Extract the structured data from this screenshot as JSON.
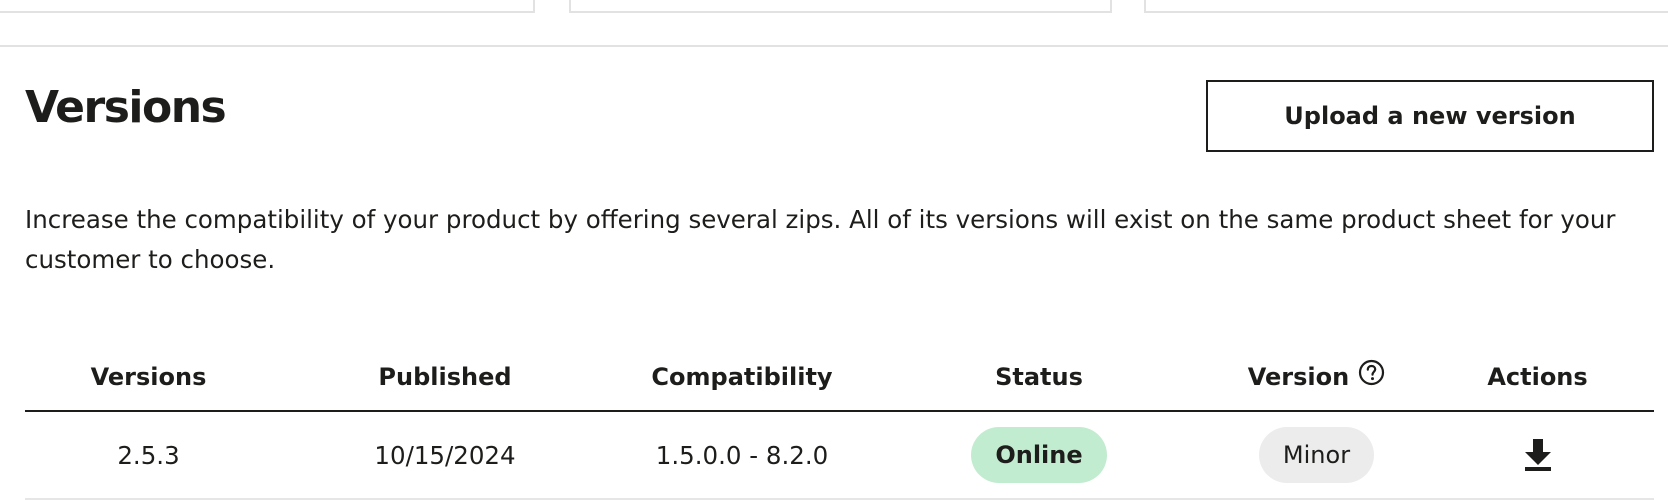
{
  "header": {
    "title": "Versions",
    "upload_label": "Upload a new version"
  },
  "description": "Increase the compatibility of your product by offering several zips. All of its versions will exist on the same product sheet for your customer to choose.",
  "table": {
    "columns": [
      "Versions",
      "Published",
      "Compatibility",
      "Status",
      "Version",
      "Actions"
    ],
    "rows": [
      {
        "version": "2.5.3",
        "published": "10/15/2024",
        "compatibility": "1.5.0.0 - 8.2.0",
        "status": "Online",
        "version_type": "Minor",
        "action_icon": "download-icon"
      }
    ]
  },
  "colors": {
    "text": "#1d1d1b",
    "online_badge_bg": "#c2ecd0",
    "minor_badge_bg": "#ececec",
    "border_light": "#e2e2e2"
  },
  "icons": {
    "version_help": "help-circle-icon",
    "download": "download-icon"
  }
}
